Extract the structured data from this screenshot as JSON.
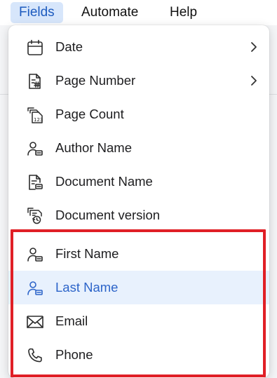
{
  "menubar": {
    "items": [
      {
        "label": "Fields",
        "active": true
      },
      {
        "label": "Automate",
        "active": false
      },
      {
        "label": "Help",
        "active": false
      }
    ]
  },
  "dropdown": {
    "items": [
      {
        "label": "Date",
        "icon": "calendar-icon",
        "submenu": true
      },
      {
        "label": "Page Number",
        "icon": "page-number-icon",
        "submenu": true
      },
      {
        "label": "Page Count",
        "icon": "page-count-icon",
        "submenu": false
      },
      {
        "label": "Author Name",
        "icon": "author-icon",
        "submenu": false
      },
      {
        "label": "Document Name",
        "icon": "document-name-icon",
        "submenu": false
      },
      {
        "label": "Document version",
        "icon": "document-version-icon",
        "submenu": false
      },
      {
        "label": "First Name",
        "icon": "user-card-icon",
        "submenu": false
      },
      {
        "label": "Last Name",
        "icon": "user-card-icon",
        "submenu": false,
        "highlighted": true
      },
      {
        "label": "Email",
        "icon": "mail-icon",
        "submenu": false
      },
      {
        "label": "Phone",
        "icon": "phone-icon",
        "submenu": false
      }
    ]
  },
  "colors": {
    "active_menu_bg": "#d7e6fb",
    "active_menu_text": "#1d5bbf",
    "highlight_row_bg": "#e8f1fd",
    "highlight_row_text": "#2c64c9",
    "annotation_box": "#e01f26"
  }
}
